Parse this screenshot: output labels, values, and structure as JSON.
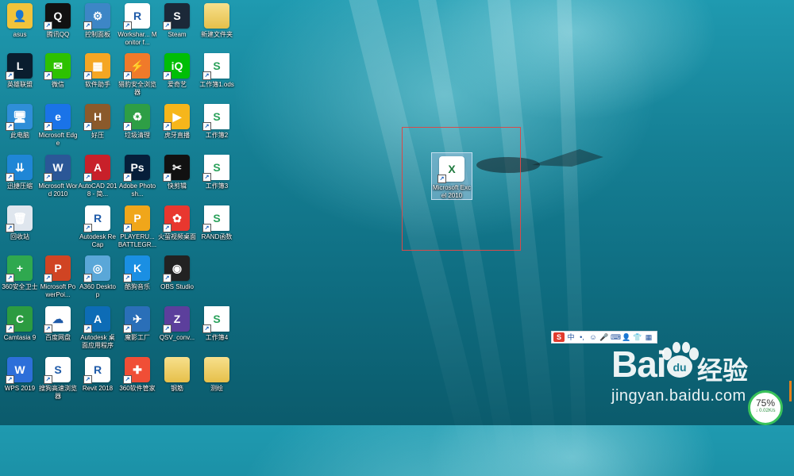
{
  "desktop_icons": [
    {
      "label": "asus",
      "color": "#f2c33b",
      "glyph": "👤",
      "type": "user"
    },
    {
      "label": "腾讯QQ",
      "color": "#111111",
      "glyph": "Q",
      "type": "app"
    },
    {
      "label": "控制面板",
      "color": "#3d86c6",
      "glyph": "⚙",
      "type": "app"
    },
    {
      "label": "Workshar... Monitor f...",
      "color": "#ffffff",
      "glyph": "R",
      "type": "app"
    },
    {
      "label": "Steam",
      "color": "#1b2838",
      "glyph": "S",
      "type": "app"
    },
    {
      "label": "新建文件夹",
      "color": "#f2d472",
      "glyph": "",
      "type": "folder"
    },
    {
      "label": "英雄联盟",
      "color": "#0a1d2e",
      "glyph": "L",
      "type": "app"
    },
    {
      "label": "微信",
      "color": "#2dc100",
      "glyph": "✉",
      "type": "app"
    },
    {
      "label": "软件助手",
      "color": "#f5a623",
      "glyph": "▦",
      "type": "app"
    },
    {
      "label": "猎豹安全浏览器",
      "color": "#f07a2a",
      "glyph": "⚡",
      "type": "app"
    },
    {
      "label": "爱奇艺",
      "color": "#00be06",
      "glyph": "iQ",
      "type": "app"
    },
    {
      "label": "工作簿1.ods",
      "color": "#ffffff",
      "glyph": "S",
      "type": "file"
    },
    {
      "label": "此电脑",
      "color": "#2f8ed8",
      "glyph": "🖥",
      "type": "app"
    },
    {
      "label": "Microsoft Edge",
      "color": "#1a73e8",
      "glyph": "e",
      "type": "app"
    },
    {
      "label": "好压",
      "color": "#8b5a2b",
      "glyph": "H",
      "type": "app"
    },
    {
      "label": "垃圾清理",
      "color": "#2e9e45",
      "glyph": "♻",
      "type": "app"
    },
    {
      "label": "虎牙直播",
      "color": "#f6b61b",
      "glyph": "▶",
      "type": "app"
    },
    {
      "label": "工作簿2",
      "color": "#ffffff",
      "glyph": "S",
      "type": "file"
    },
    {
      "label": "迅捷压缩",
      "color": "#1f86d6",
      "glyph": "⇊",
      "type": "app"
    },
    {
      "label": "Microsoft Word 2010",
      "color": "#2b5797",
      "glyph": "W",
      "type": "app"
    },
    {
      "label": "AutoCAD 2018 - 简...",
      "color": "#c8202a",
      "glyph": "A",
      "type": "app"
    },
    {
      "label": "Adobe Photosh...",
      "color": "#061e3a",
      "glyph": "Ps",
      "type": "app"
    },
    {
      "label": "快剪辑",
      "color": "#111111",
      "glyph": "✂",
      "type": "app"
    },
    {
      "label": "工作簿3",
      "color": "#ffffff",
      "glyph": "S",
      "type": "file"
    },
    {
      "label": "回收站",
      "color": "#dfe6ee",
      "glyph": "🗑",
      "type": "app"
    },
    {
      "label": "",
      "color": "transparent",
      "glyph": "",
      "type": "empty"
    },
    {
      "label": "Autodesk ReCap",
      "color": "#ffffff",
      "glyph": "R",
      "type": "app"
    },
    {
      "label": "PLAYERU... BATTLEGR...",
      "color": "#f0a61a",
      "glyph": "P",
      "type": "app"
    },
    {
      "label": "火萤视频桌面",
      "color": "#e8372f",
      "glyph": "✿",
      "type": "app"
    },
    {
      "label": "RAND函数",
      "color": "#ffffff",
      "glyph": "S",
      "type": "file"
    },
    {
      "label": "360安全卫士",
      "color": "#2fa84f",
      "glyph": "+",
      "type": "app"
    },
    {
      "label": "Microsoft PowerPoi...",
      "color": "#d04423",
      "glyph": "P",
      "type": "app"
    },
    {
      "label": "A360 Desktop",
      "color": "#5aa7d8",
      "glyph": "◎",
      "type": "app"
    },
    {
      "label": "酷狗音乐",
      "color": "#1a8fe3",
      "glyph": "K",
      "type": "app"
    },
    {
      "label": "OBS Studio",
      "color": "#222222",
      "glyph": "◉",
      "type": "app"
    },
    {
      "label": "",
      "color": "transparent",
      "glyph": "",
      "type": "empty"
    },
    {
      "label": "Camtasia 9",
      "color": "#2c9b41",
      "glyph": "C",
      "type": "app"
    },
    {
      "label": "百度网盘",
      "color": "#ffffff",
      "glyph": "☁",
      "type": "app"
    },
    {
      "label": "Autodesk 桌面应用程序",
      "color": "#0d6cb6",
      "glyph": "A",
      "type": "app"
    },
    {
      "label": "魔影工厂",
      "color": "#2a6fb8",
      "glyph": "✈",
      "type": "app"
    },
    {
      "label": "QSV_conv...",
      "color": "#5c3f9c",
      "glyph": "Z",
      "type": "app"
    },
    {
      "label": "工作簿4",
      "color": "#ffffff",
      "glyph": "S",
      "type": "file"
    },
    {
      "label": "WPS 2019",
      "color": "#2d6fd9",
      "glyph": "W",
      "type": "app"
    },
    {
      "label": "搜狗高速浏览器",
      "color": "#ffffff",
      "glyph": "S",
      "type": "app"
    },
    {
      "label": "Revit 2018",
      "color": "#ffffff",
      "glyph": "R",
      "type": "app"
    },
    {
      "label": "360软件管家",
      "color": "#f04e36",
      "glyph": "✚",
      "type": "app"
    },
    {
      "label": "钢筋",
      "color": "#f2d472",
      "glyph": "",
      "type": "folder"
    },
    {
      "label": "测绘",
      "color": "#f2d472",
      "glyph": "",
      "type": "folder"
    }
  ],
  "selected_icon": {
    "label": "Microsoft Excel 2010",
    "glyph": "X"
  },
  "ime_toolbar": {
    "logo": "S",
    "buttons": [
      "中",
      "•,",
      "☺",
      "🎤",
      "⌨",
      "👤",
      "👕",
      "▦"
    ]
  },
  "watermark": {
    "brand": "Bai",
    "cn": "经验",
    "url": "jingyan.baidu.com"
  },
  "network_gauge": {
    "percent": "75%",
    "speed": "↓ 0.02K/s"
  }
}
